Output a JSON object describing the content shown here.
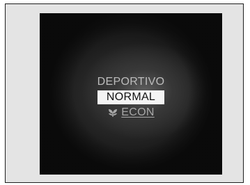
{
  "modes": [
    {
      "label": "DEPORTIVO",
      "selected": false
    },
    {
      "label": "NORMAL",
      "selected": true
    },
    {
      "label": "ECON",
      "selected": false,
      "icon": "leaf-icon"
    }
  ],
  "colors": {
    "screen_background": "#131313",
    "selected_background": "#f4f4f4",
    "selected_text": "#111111",
    "unselected_text": "#bdbdbd",
    "frame_background": "#e4e4e4"
  }
}
